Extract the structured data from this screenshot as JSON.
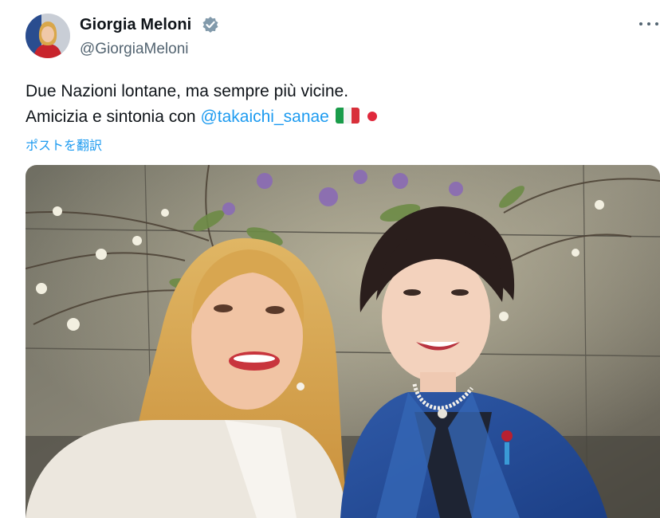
{
  "author": {
    "display_name": "Giorgia Meloni",
    "handle": "@GiorgiaMeloni",
    "verified": true,
    "avatar_icon": "profile-avatar"
  },
  "post": {
    "line1": "Due Nazioni lontane, ma sempre più vicine.",
    "line2_prefix": "Amicizia e sintonia con ",
    "mention": "@takaichi_sanae",
    "emoji": [
      "italy-flag-emoji",
      "japan-flag-emoji"
    ],
    "translate_label": "ポストを翻訳"
  },
  "menu": {
    "icon": "more-options-icon"
  },
  "media": {
    "type": "photo"
  },
  "colors": {
    "text": "#0f1419",
    "secondary": "#536471",
    "accent": "#1d9bf0",
    "verified_badge": "#829aab"
  }
}
